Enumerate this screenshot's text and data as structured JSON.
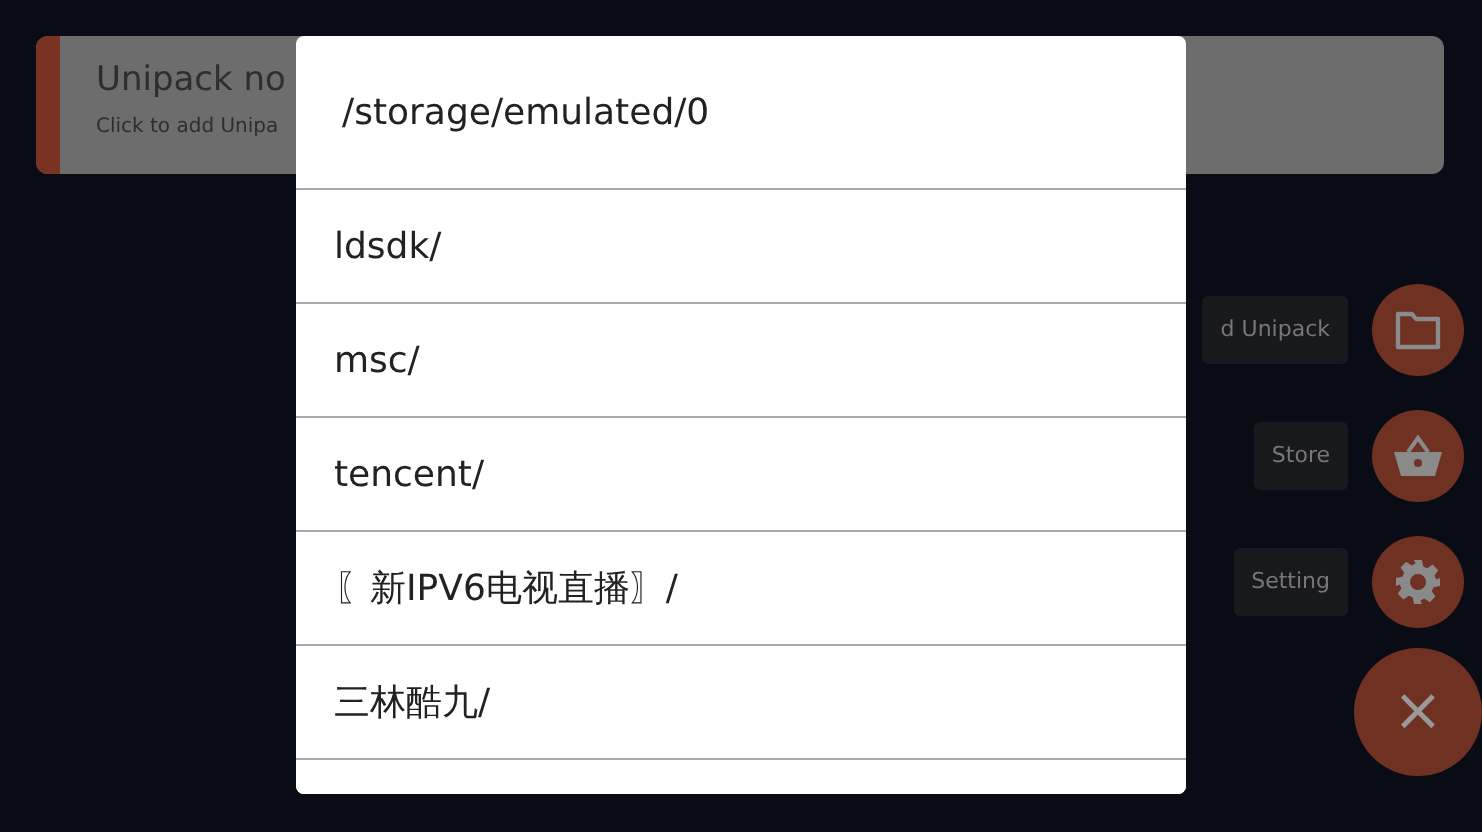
{
  "notice_card": {
    "title": "Unipack no",
    "subtitle": "Click to add Unipa"
  },
  "fab_menu": [
    {
      "kind": "folder",
      "label": "d Unipack"
    },
    {
      "kind": "basket",
      "label": "Store"
    },
    {
      "kind": "gear",
      "label": "Setting"
    }
  ],
  "close_fab": {
    "symbol": "×"
  },
  "dialog": {
    "path": "/storage/emulated/0",
    "items": [
      "ldsdk/",
      "msc/",
      "tencent/",
      "〖新IPV6电视直播〗/",
      "三林酷九/"
    ]
  }
}
